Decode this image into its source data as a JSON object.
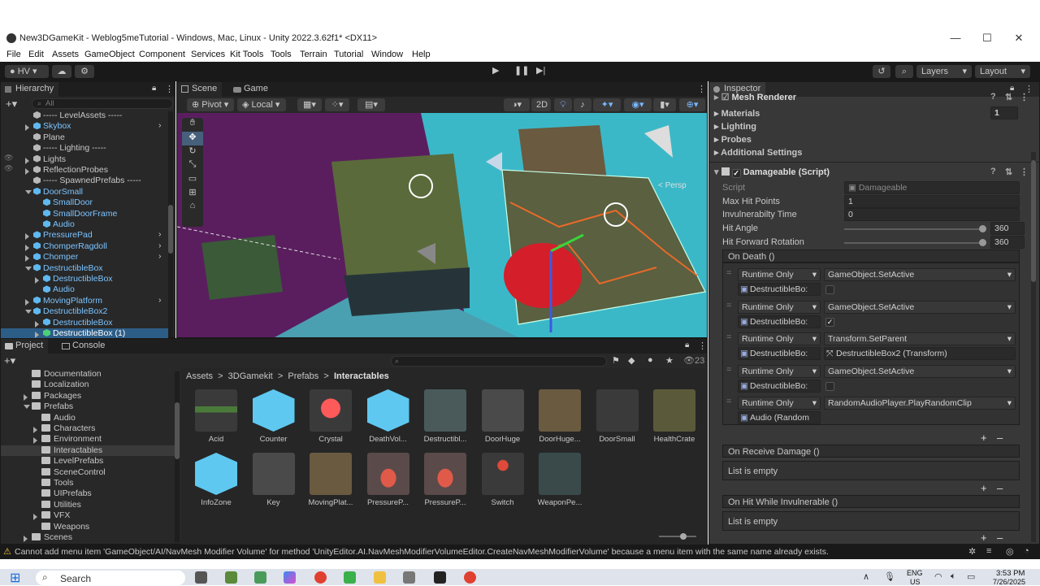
{
  "window": {
    "title": "New3DGameKit - Weblog5meTutorial - Windows, Mac, Linux - Unity 2022.3.62f1* <DX11>",
    "minimize": "—",
    "maximize": "☐",
    "close": "✕"
  },
  "menu": [
    "File",
    "Edit",
    "Assets",
    "GameObject",
    "Component",
    "Services",
    "Kit Tools",
    "Tools",
    "Terrain",
    "Tutorial",
    "Window",
    "Help"
  ],
  "toolbar": {
    "account": "HV",
    "layers": "Layers",
    "layout": "Layout"
  },
  "hierarchy": {
    "tab": "Hierarchy",
    "search_placeholder": "All",
    "items": [
      {
        "label": "----- LevelAssets -----",
        "indent": 1,
        "icon": "gameobject",
        "blue": false
      },
      {
        "label": "Skybox",
        "indent": 1,
        "icon": "prefab",
        "blue": true,
        "arrow": "right"
      },
      {
        "label": "Plane",
        "indent": 1,
        "icon": "gameobject",
        "blue": false
      },
      {
        "label": "----- Lighting -----",
        "indent": 1,
        "icon": "gameobject",
        "blue": false
      },
      {
        "label": "Lights",
        "indent": 1,
        "icon": "gameobject",
        "blue": false,
        "arrow": "right"
      },
      {
        "label": "ReflectionProbes",
        "indent": 1,
        "icon": "gameobject",
        "blue": false,
        "arrow": "right"
      },
      {
        "label": "----- SpawnedPrefabs -----",
        "indent": 1,
        "icon": "gameobject",
        "blue": false
      },
      {
        "label": "DoorSmall",
        "indent": 1,
        "icon": "prefab",
        "blue": true,
        "arrow": "down"
      },
      {
        "label": "SmallDoor",
        "indent": 2,
        "icon": "prefab",
        "blue": true
      },
      {
        "label": "SmallDoorFrame",
        "indent": 2,
        "icon": "prefab",
        "blue": true
      },
      {
        "label": "Audio",
        "indent": 2,
        "icon": "prefab",
        "blue": true
      },
      {
        "label": "PressurePad",
        "indent": 1,
        "icon": "prefab",
        "blue": true,
        "arrow": "right"
      },
      {
        "label": "ChomperRagdoll",
        "indent": 1,
        "icon": "prefab",
        "blue": true,
        "arrow": "right"
      },
      {
        "label": "Chomper",
        "indent": 1,
        "icon": "prefab",
        "blue": true,
        "arrow": "right"
      },
      {
        "label": "DestructibleBox",
        "indent": 1,
        "icon": "prefab",
        "blue": true,
        "arrow": "down"
      },
      {
        "label": "DestructibleBox",
        "indent": 2,
        "icon": "prefab",
        "blue": true,
        "arrow": "right"
      },
      {
        "label": "Audio",
        "indent": 2,
        "icon": "prefab",
        "blue": true
      },
      {
        "label": "MovingPlatform",
        "indent": 1,
        "icon": "prefab",
        "blue": true,
        "arrow": "right"
      },
      {
        "label": "DestructibleBox2",
        "indent": 1,
        "icon": "prefab",
        "blue": true,
        "arrow": "down"
      },
      {
        "label": "DestructibleBox",
        "indent": 2,
        "icon": "prefab",
        "blue": true,
        "arrow": "right"
      },
      {
        "label": "DestructibleBox (1)",
        "indent": 2,
        "icon": "prefab",
        "blue": false,
        "arrow": "right",
        "selected": true
      }
    ]
  },
  "scene": {
    "tab_scene": "Scene",
    "tab_game": "Game",
    "pivot": "Pivot",
    "local": "Local",
    "mode2d": "2D",
    "persp": "< Persp"
  },
  "project": {
    "tab_project": "Project",
    "tab_console": "Console",
    "tree": [
      {
        "label": "Documentation",
        "indent": 1
      },
      {
        "label": "Localization",
        "indent": 1
      },
      {
        "label": "Packages",
        "indent": 1,
        "arrow": "right"
      },
      {
        "label": "Prefabs",
        "indent": 1,
        "arrow": "down"
      },
      {
        "label": "Audio",
        "indent": 2
      },
      {
        "label": "Characters",
        "indent": 2,
        "arrow": "right"
      },
      {
        "label": "Environment",
        "indent": 2,
        "arrow": "right"
      },
      {
        "label": "Interactables",
        "indent": 2,
        "selected": true
      },
      {
        "label": "LevelPrefabs",
        "indent": 2
      },
      {
        "label": "SceneControl",
        "indent": 2
      },
      {
        "label": "Tools",
        "indent": 2
      },
      {
        "label": "UIPrefabs",
        "indent": 2
      },
      {
        "label": "Utilities",
        "indent": 2
      },
      {
        "label": "VFX",
        "indent": 2,
        "arrow": "right"
      },
      {
        "label": "Weapons",
        "indent": 2
      },
      {
        "label": "Scenes",
        "indent": 1,
        "arrow": "right"
      }
    ],
    "breadcrumb": [
      "Assets",
      "3DGamekit",
      "Prefabs",
      "Interactables"
    ],
    "count": "23",
    "assets": [
      {
        "label": "Acid",
        "kind": "acid"
      },
      {
        "label": "Counter",
        "kind": "cube"
      },
      {
        "label": "Crystal",
        "kind": "crystal"
      },
      {
        "label": "DeathVol...",
        "kind": "cube"
      },
      {
        "label": "Destructibl...",
        "kind": "box"
      },
      {
        "label": "DoorHuge",
        "kind": "dark"
      },
      {
        "label": "DoorHuge...",
        "kind": "door"
      },
      {
        "label": "DoorSmall",
        "kind": "doorsmall"
      },
      {
        "label": "HealthCrate",
        "kind": "crate"
      },
      {
        "label": "InfoZone",
        "kind": "cube"
      },
      {
        "label": "Key",
        "kind": "key"
      },
      {
        "label": "MovingPlat...",
        "kind": "platform"
      },
      {
        "label": "PressureP...",
        "kind": "pad"
      },
      {
        "label": "PressureP...",
        "kind": "pad"
      },
      {
        "label": "Switch",
        "kind": "switch"
      },
      {
        "label": "WeaponPe...",
        "kind": "weapon"
      }
    ]
  },
  "inspector": {
    "tab": "Inspector",
    "mesh_renderer": "Mesh Renderer",
    "foldouts": [
      "Materials",
      "Lighting",
      "Probes",
      "Additional Settings"
    ],
    "materials_count": "1",
    "component": "Damageable (Script)",
    "fields": {
      "script_label": "Script",
      "script_value": "Damageable",
      "max_hp_label": "Max Hit Points",
      "max_hp_value": "1",
      "invuln_label": "Invulnerabilty Time",
      "invuln_value": "0",
      "hit_angle_label": "Hit Angle",
      "hit_angle_value": "360",
      "hit_fwd_label": "Hit Forward Rotation",
      "hit_fwd_value": "360"
    },
    "on_death": {
      "title": "On Death ()",
      "entries": [
        {
          "mode": "Runtime Only",
          "function": "GameObject.SetActive",
          "target": "DestructibleBo:",
          "arg": "unchecked"
        },
        {
          "mode": "Runtime Only",
          "function": "GameObject.SetActive",
          "target": "DestructibleBo:",
          "arg": "checked"
        },
        {
          "mode": "Runtime Only",
          "function": "Transform.SetParent",
          "target": "DestructibleBo:",
          "arg": "DestructibleBox2 (Transform)"
        },
        {
          "mode": "Runtime Only",
          "function": "GameObject.SetActive",
          "target": "DestructibleBo:",
          "arg": "unchecked"
        },
        {
          "mode": "Runtime Only",
          "function": "RandomAudioPlayer.PlayRandomClip",
          "target": "Audio (Random",
          "arg": ""
        }
      ]
    },
    "on_receive_damage": {
      "title": "On Receive Damage ()",
      "empty": "List is empty"
    },
    "on_hit_invulnerable": {
      "title": "On Hit While Invulnerable ()",
      "empty": "List is empty"
    }
  },
  "status": "Cannot add menu item 'GameObject/AI/NavMesh Modifier Volume' for method 'UnityEditor.AI.NavMeshModifierVolumeEditor.CreateNavMeshModifierVolume' because a menu item with the same name already exists.",
  "taskbar": {
    "search": "Search",
    "lang": "ENG",
    "lang2": "US",
    "time": "3:53 PM",
    "date": "7/26/2025"
  }
}
